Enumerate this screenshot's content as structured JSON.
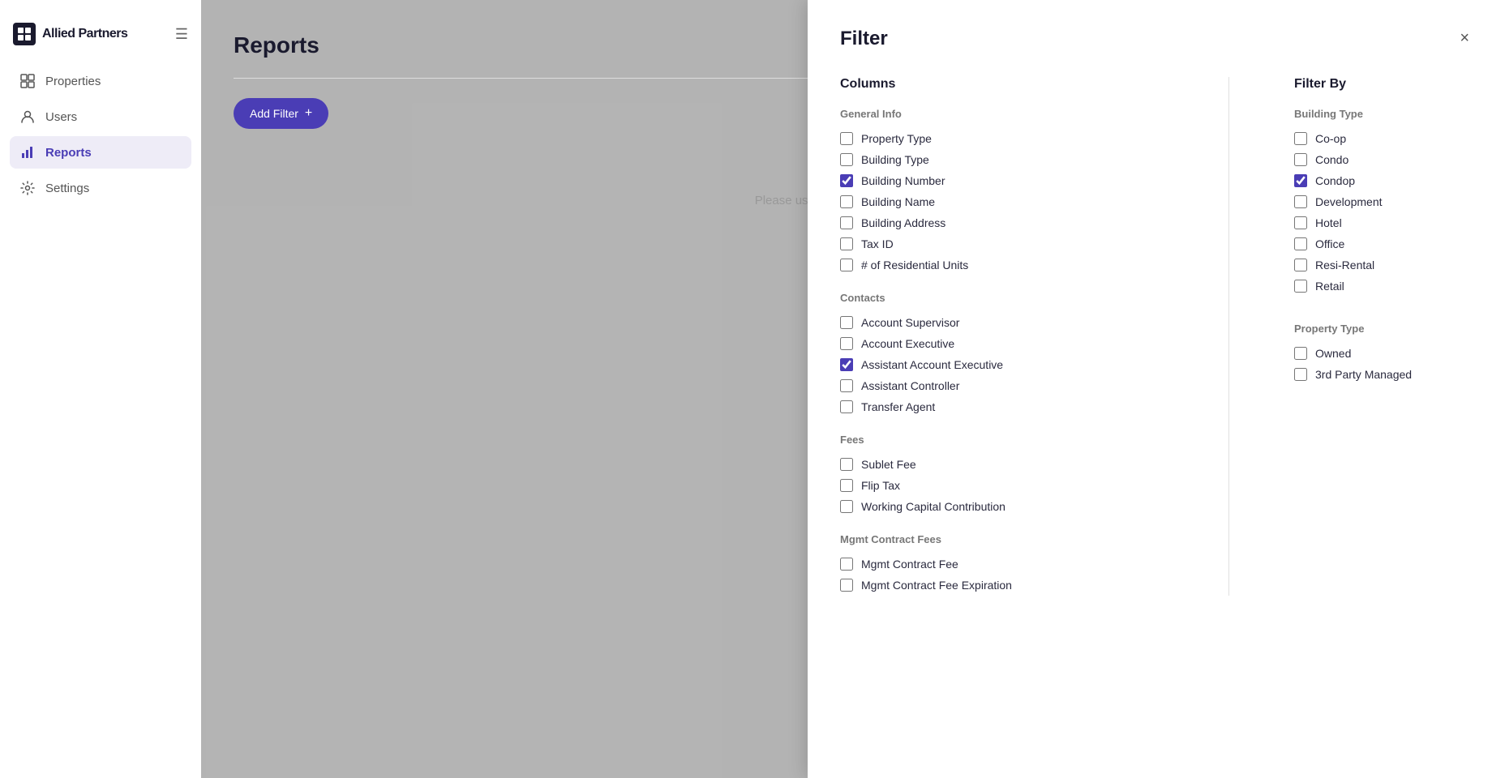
{
  "sidebar": {
    "logo_text": "Allied Partners",
    "nav_items": [
      {
        "id": "properties",
        "label": "Properties",
        "active": false
      },
      {
        "id": "users",
        "label": "Users",
        "active": false
      },
      {
        "id": "reports",
        "label": "Reports",
        "active": true
      },
      {
        "id": "settings",
        "label": "Settings",
        "active": false
      }
    ]
  },
  "main": {
    "page_title": "Reports",
    "add_filter_label": "Add Filter",
    "placeholder_text": "Please use filters to run a custom r..."
  },
  "filter_panel": {
    "title": "Filter",
    "close_icon": "×",
    "columns_title": "Columns",
    "filter_by_title": "Filter By",
    "general_info": {
      "label": "General Info",
      "items": [
        {
          "id": "property_type",
          "label": "Property Type",
          "checked": false
        },
        {
          "id": "building_type",
          "label": "Building Type",
          "checked": false
        },
        {
          "id": "building_number",
          "label": "Building Number",
          "checked": true
        },
        {
          "id": "building_name",
          "label": "Building Name",
          "checked": false
        },
        {
          "id": "building_address",
          "label": "Building Address",
          "checked": false
        },
        {
          "id": "tax_id",
          "label": "Tax ID",
          "checked": false
        },
        {
          "id": "residential_units",
          "label": "# of Residential Units",
          "checked": false
        }
      ]
    },
    "contacts": {
      "label": "Contacts",
      "items": [
        {
          "id": "account_supervisor",
          "label": "Account Supervisor",
          "checked": false
        },
        {
          "id": "account_executive",
          "label": "Account Executive",
          "checked": false
        },
        {
          "id": "assistant_account_executive",
          "label": "Assistant Account Executive",
          "checked": true
        },
        {
          "id": "assistant_controller",
          "label": "Assistant Controller",
          "checked": false
        },
        {
          "id": "transfer_agent",
          "label": "Transfer Agent",
          "checked": false
        }
      ]
    },
    "fees": {
      "label": "Fees",
      "items": [
        {
          "id": "sublet_fee",
          "label": "Sublet Fee",
          "checked": false
        },
        {
          "id": "flip_tax",
          "label": "Flip Tax",
          "checked": false
        },
        {
          "id": "working_capital",
          "label": "Working Capital Contribution",
          "checked": false
        }
      ]
    },
    "mgmt_contract_fees": {
      "label": "Mgmt Contract Fees",
      "items": [
        {
          "id": "mgmt_contract_fee",
          "label": "Mgmt Contract Fee",
          "checked": false
        },
        {
          "id": "mgmt_contract_fee_expiration",
          "label": "Mgmt Contract Fee Expiration",
          "checked": false
        }
      ]
    },
    "building_type": {
      "label": "Building Type",
      "items": [
        {
          "id": "coop",
          "label": "Co-op",
          "checked": false
        },
        {
          "id": "condo",
          "label": "Condo",
          "checked": false
        },
        {
          "id": "condop",
          "label": "Condop",
          "checked": true
        },
        {
          "id": "development",
          "label": "Development",
          "checked": false
        },
        {
          "id": "hotel",
          "label": "Hotel",
          "checked": false
        },
        {
          "id": "office",
          "label": "Office",
          "checked": false
        },
        {
          "id": "resi_rental",
          "label": "Resi-Rental",
          "checked": false
        },
        {
          "id": "retail",
          "label": "Retail",
          "checked": false
        }
      ]
    },
    "property_type": {
      "label": "Property Type",
      "items": [
        {
          "id": "owned",
          "label": "Owned",
          "checked": false
        },
        {
          "id": "third_party_managed",
          "label": "3rd Party Managed",
          "checked": false
        }
      ]
    }
  }
}
